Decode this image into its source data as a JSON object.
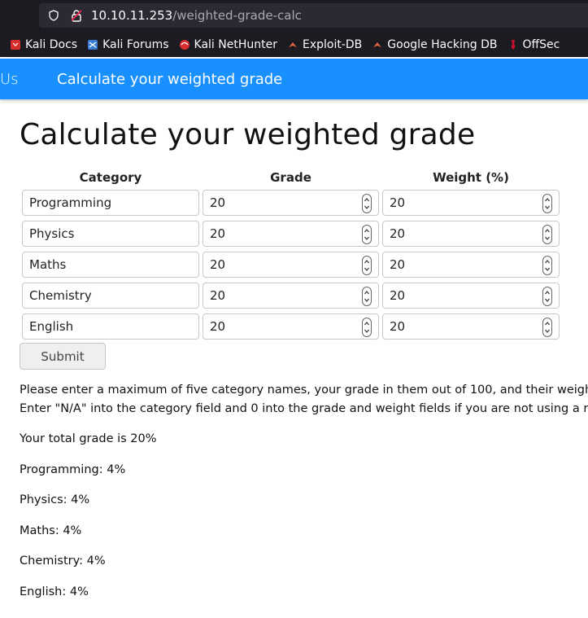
{
  "browser": {
    "url_host": "10.10.11.253",
    "url_path": "/weighted-grade-calc",
    "bookmarks": [
      {
        "label": "Kali Docs",
        "icon": "kali-docs-icon",
        "color": "#d92e2e"
      },
      {
        "label": "Kali Forums",
        "icon": "kali-forums-icon",
        "color": "#3a7bd5"
      },
      {
        "label": "Kali NetHunter",
        "icon": "kali-nethunter-icon",
        "color": "#d92e2e"
      },
      {
        "label": "Exploit-DB",
        "icon": "exploit-db-icon",
        "color": "#e0643c"
      },
      {
        "label": "Google Hacking DB",
        "icon": "ghdb-icon",
        "color": "#e0643c"
      },
      {
        "label": "OffSec",
        "icon": "offsec-icon",
        "color": "#c8102e"
      }
    ]
  },
  "navbar": {
    "left_text": "Us",
    "title": "Calculate your weighted grade",
    "color": "#1890ff"
  },
  "main": {
    "title": "Calculate your weighted grade",
    "headers": {
      "category": "Category",
      "grade": "Grade",
      "weight": "Weight (%)"
    },
    "rows": [
      {
        "category": "Programming",
        "grade": "20",
        "weight": "20"
      },
      {
        "category": "Physics",
        "grade": "20",
        "weight": "20"
      },
      {
        "category": "Maths",
        "grade": "20",
        "weight": "20"
      },
      {
        "category": "Chemistry",
        "grade": "20",
        "weight": "20"
      },
      {
        "category": "English",
        "grade": "20",
        "weight": "20"
      }
    ],
    "submit_label": "Submit",
    "instructions_line1": "Please enter a maximum of five category names, your grade in them out of 100, and their weight.",
    "instructions_line2": "Enter \"N/A\" into the category field and 0 into the grade and weight fields if you are not using a row.",
    "total": "Your total grade is 20%",
    "results": [
      "Programming: 4%",
      "Physics: 4%",
      "Maths: 4%",
      "Chemistry: 4%",
      "English: 4%"
    ]
  }
}
